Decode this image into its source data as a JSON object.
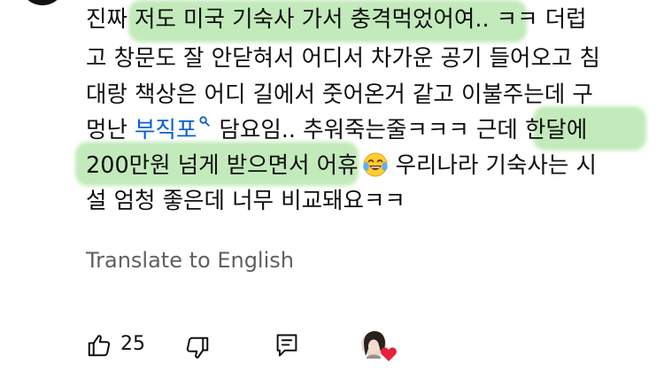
{
  "comment": {
    "line1": {
      "pre": "진짜 ",
      "mark": "저도 미국 기숙사 가서 충격먹었어여",
      "post": ".. ㅋㅋ 더럽"
    },
    "line2": "고 창문도 잘 안닫혀서 어디서 차가운 공기 들어오고 침",
    "line3": "대랑 책상은 어디 길에서 줏어온거 같고 이불주는데 구",
    "line4": {
      "pre": "멍난 ",
      "hashtag": "부직포",
      "mid": "담요임.. 추워죽는줄ㅋㅋㅋ 근데 ",
      "mark": "한달에"
    },
    "line5": {
      "mark": "200만원 넘게 받으면서 어휴",
      "post": "우리나라 기숙사는 시"
    },
    "line6": "설 엄청 좋은데 너무 비교돼요ㅋㅋ"
  },
  "translate": {
    "label": "Translate to English"
  },
  "actions": {
    "like_count": "25"
  },
  "icons": {
    "hashtag_search": "search-icon",
    "emoji": "laughing-tears-emoji",
    "like": "thumbs-up-icon",
    "dislike": "thumbs-down-icon",
    "reply": "reply-icon",
    "creator_heart": "creator-heart-avatar"
  },
  "colors": {
    "highlight": "#87d678",
    "hashtag": "#065fd4",
    "muted_text": "#606060",
    "heart": "#e8203a"
  }
}
